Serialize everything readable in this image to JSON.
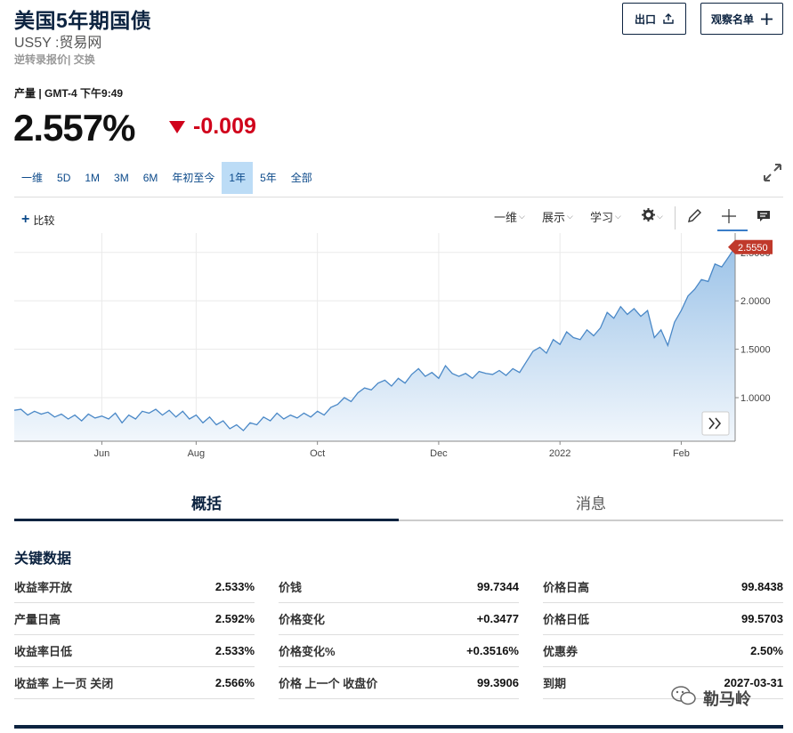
{
  "header": {
    "title": "美国5年期国债",
    "symbol_line": "US5Y :贸易网",
    "exchange_line": "逆转录报价| 交换",
    "export_label": "出口",
    "watchlist_label": "观察名单"
  },
  "quote": {
    "meta": "产量 | GMT-4 下午9:49",
    "price": "2.557%",
    "change": "-0.009",
    "change_color": "#d0021b"
  },
  "ranges": [
    "一维",
    "5D",
    "1M",
    "3M",
    "6M",
    "年初至今",
    "1年",
    "5年",
    "全部"
  ],
  "active_range": "1年",
  "toolbar": {
    "compare_label": "比较",
    "interval_label": "一维",
    "display_label": "展示",
    "studies_label": "学习"
  },
  "chart_data": {
    "type": "area",
    "x_tick_labels": [
      "Jun",
      "Aug",
      "Oct",
      "Dec",
      "2022",
      "Feb"
    ],
    "y_tick_labels": [
      "1.0000",
      "1.5000",
      "2.0000",
      "2.5000"
    ],
    "ylim": [
      0.55,
      2.7
    ],
    "last_value_label": "2.5550",
    "series": [
      {
        "values": [
          0.87,
          0.88,
          0.82,
          0.86,
          0.83,
          0.85,
          0.8,
          0.83,
          0.78,
          0.82,
          0.76,
          0.83,
          0.79,
          0.81,
          0.78,
          0.84,
          0.74,
          0.82,
          0.78,
          0.86,
          0.84,
          0.88,
          0.82,
          0.87,
          0.8,
          0.86,
          0.78,
          0.82,
          0.74,
          0.8,
          0.72,
          0.76,
          0.68,
          0.72,
          0.66,
          0.74,
          0.72,
          0.8,
          0.76,
          0.84,
          0.78,
          0.82,
          0.79,
          0.84,
          0.8,
          0.86,
          0.82,
          0.9,
          0.93,
          1.0,
          0.96,
          1.05,
          1.1,
          1.08,
          1.15,
          1.18,
          1.12,
          1.2,
          1.15,
          1.24,
          1.3,
          1.22,
          1.26,
          1.2,
          1.33,
          1.25,
          1.22,
          1.25,
          1.2,
          1.27,
          1.25,
          1.24,
          1.28,
          1.23,
          1.3,
          1.26,
          1.37,
          1.48,
          1.52,
          1.46,
          1.6,
          1.55,
          1.68,
          1.62,
          1.6,
          1.7,
          1.64,
          1.72,
          1.88,
          1.82,
          1.94,
          1.86,
          1.92,
          1.84,
          1.9,
          1.62,
          1.7,
          1.54,
          1.78,
          1.9,
          2.05,
          2.12,
          2.22,
          2.2,
          2.38,
          2.35,
          2.45,
          2.555
        ]
      }
    ]
  }
}
